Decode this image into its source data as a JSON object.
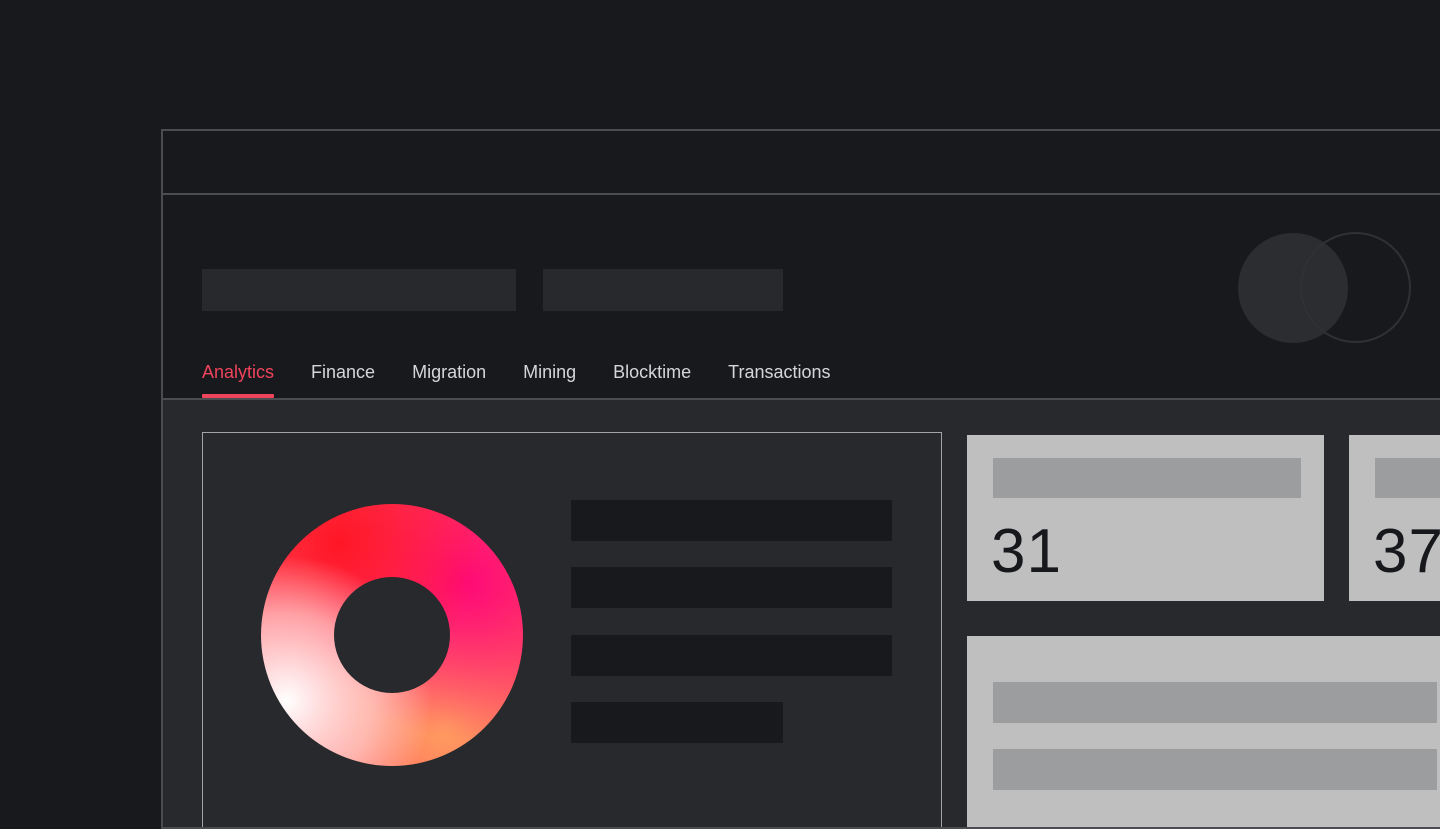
{
  "tabs": [
    {
      "label": "Analytics",
      "active": true
    },
    {
      "label": "Finance",
      "active": false
    },
    {
      "label": "Migration",
      "active": false
    },
    {
      "label": "Mining",
      "active": false
    },
    {
      "label": "Blocktime",
      "active": false
    },
    {
      "label": "Transactions",
      "active": false
    }
  ],
  "stats": [
    {
      "value": "31"
    },
    {
      "value": "37"
    }
  ],
  "colors": {
    "accent": "#f0435c",
    "background": "#18191d",
    "panel": "#27292c",
    "card": "#bfbfc0",
    "donut_gradient": [
      "#ff1a2e",
      "#ff0a78",
      "#ff3b52",
      "#ffa06a",
      "#fff4ec",
      "#ffffff"
    ]
  }
}
